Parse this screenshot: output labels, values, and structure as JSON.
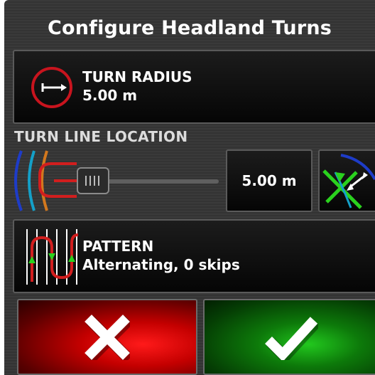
{
  "title": "Configure Headland Turns",
  "turn_radius": {
    "label": "TURN RADIUS",
    "value": "5.00 m",
    "icon": "turn-radius-icon"
  },
  "turn_line_location": {
    "label": "TURN LINE LOCATION",
    "value": "5.00 m",
    "slider_icon": "headland-turn-line-icon",
    "nudge_icon": "nudge-line-icon"
  },
  "pattern": {
    "label": "PATTERN",
    "value": "Alternating, 0 skips",
    "icon": "pattern-icon"
  },
  "actions": {
    "cancel_icon": "close-icon",
    "confirm_icon": "checkmark-icon"
  },
  "colors": {
    "cancel": "#e00000",
    "confirm": "#14a010",
    "accent_red": "#c8141e"
  }
}
